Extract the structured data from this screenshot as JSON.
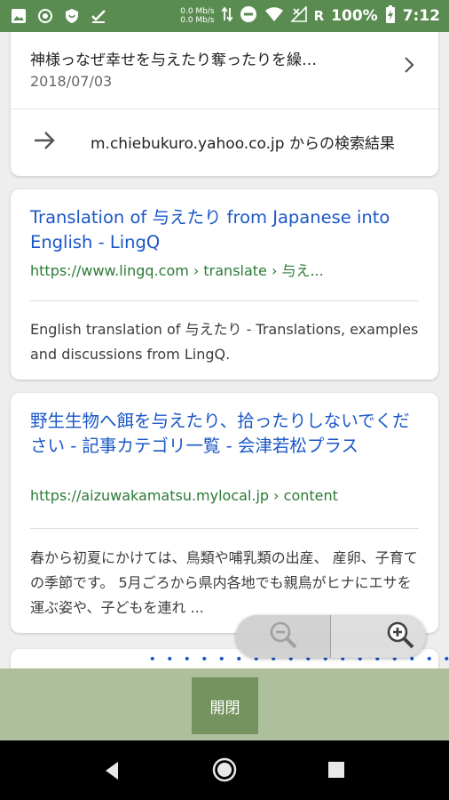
{
  "status_bar": {
    "net_up": "0.0 Mb/s",
    "net_down": "0.0 Mb/s",
    "network_badge": "R",
    "battery": "100%",
    "time": "7:12",
    "icons": [
      "image-icon",
      "circle-icon",
      "shield-icon",
      "tasks-icon",
      "data-arrows-icon",
      "do-not-disturb-icon",
      "wifi-icon",
      "no-signal-icon",
      "battery-charging-icon"
    ]
  },
  "card_top": {
    "result_title": "神様っなぜ幸せを与えたり奪ったりを繰…",
    "result_date": "2018/07/03",
    "more_results": "m.chiebukuro.yahoo.co.jp からの検索結果"
  },
  "results": [
    {
      "title": "Translation of 与えたり from Japanese into English - LingQ",
      "url": "https://www.lingq.com › translate › 与え...",
      "snippet": "English translation of 与えたり - Translations, examples and discussions from LingQ."
    },
    {
      "title": "野生生物へ餌を与えたり、拾ったりしないでください - 記事カテゴリ一覧 - 会津若松プラス",
      "url": "https://aizuwakamatsu.mylocal.jp › content",
      "snippet": "春から初夏にかけては、鳥類や哺乳類の出産、 産卵、子育ての季節です。 5月ごろから県内各地でも親鳥がヒナにエサを運ぶ姿や、子どもを連れ ..."
    },
    {
      "title": "・・・・・・・・・・・・・・・・・・・・"
    }
  ],
  "toolbar": {
    "open_close_label": "開閉"
  },
  "zoom": {
    "zoom_out_icon": "zoom-out-icon",
    "zoom_in_icon": "zoom-in-icon"
  },
  "colors": {
    "status_bar": "#5a8c52",
    "link": "#1a57c8",
    "url": "#2b7a36",
    "toolbar": "#aebf9c",
    "button": "#74935f"
  }
}
